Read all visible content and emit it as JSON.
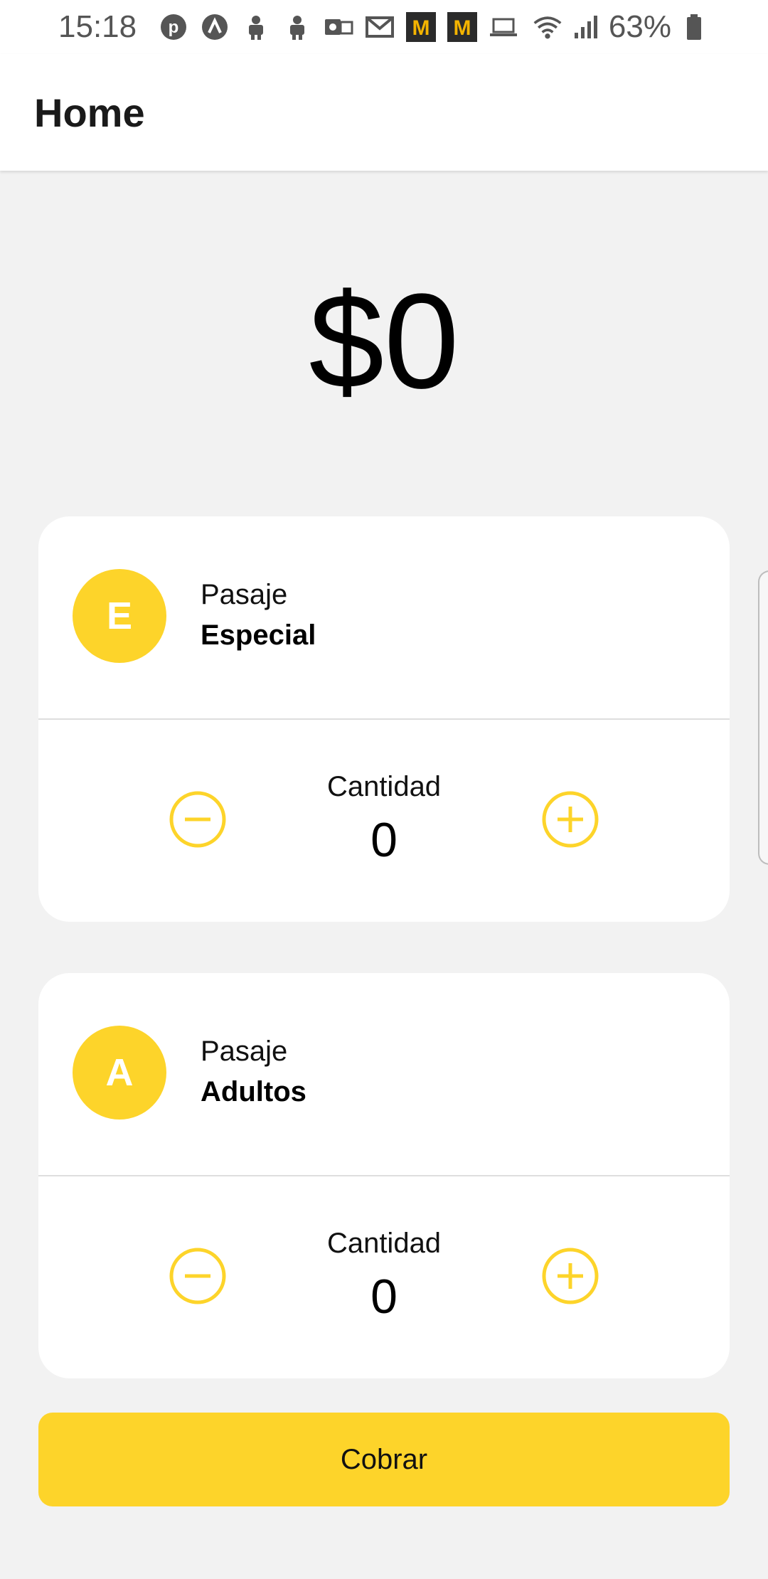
{
  "status_bar": {
    "time": "15:18",
    "battery": "63%",
    "notification_icons": [
      "pinterest-icon",
      "arrow-app-icon",
      "android-robot-icon",
      "android-robot-icon",
      "outlook-icon",
      "gmail-icon",
      "m-app-icon",
      "m-app-icon",
      "laptop-icon"
    ]
  },
  "app_bar": {
    "title": "Home"
  },
  "total": "$0",
  "tickets": [
    {
      "initial": "E",
      "label": "Pasaje",
      "type": "Especial",
      "quantity_label": "Cantidad",
      "quantity": "0"
    },
    {
      "initial": "A",
      "label": "Pasaje",
      "type": "Adultos",
      "quantity_label": "Cantidad",
      "quantity": "0"
    }
  ],
  "charge_button": "Cobrar",
  "colors": {
    "accent": "#fdd42a",
    "background": "#f2f2f2",
    "card": "#ffffff"
  }
}
